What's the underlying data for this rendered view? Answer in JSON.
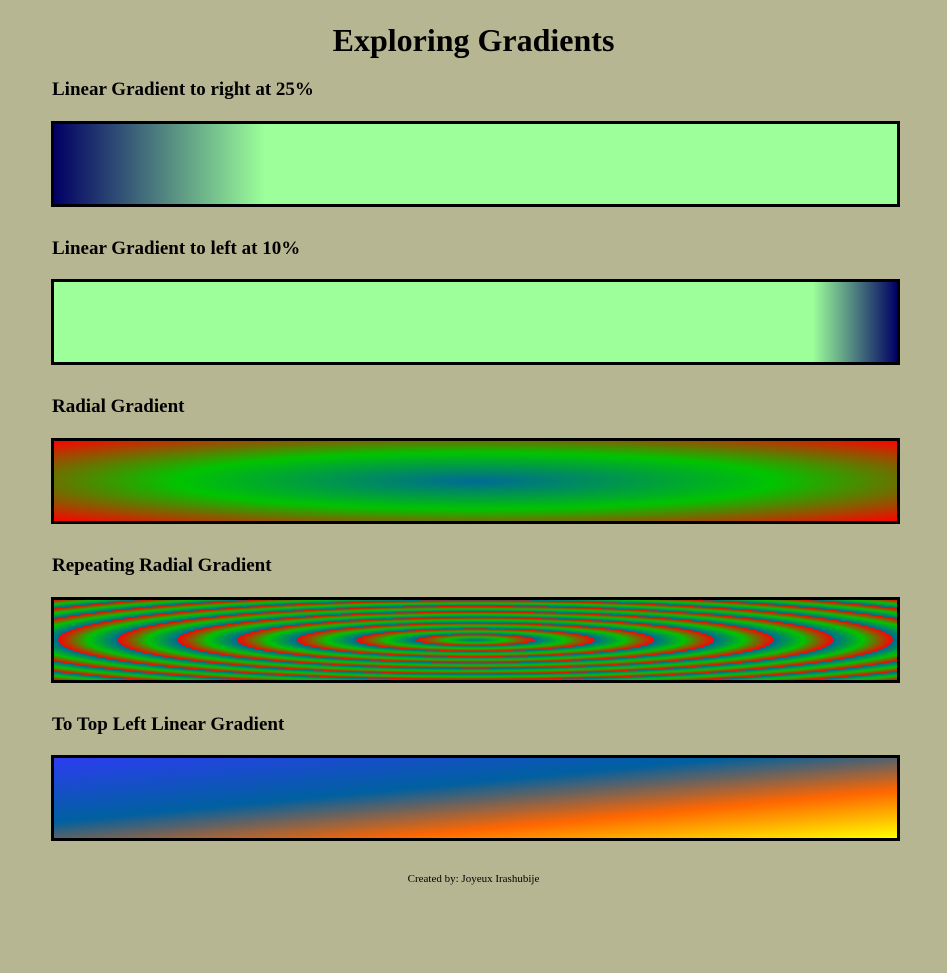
{
  "page": {
    "title": "Exploring Gradients",
    "background_color": "#b7b693"
  },
  "sections": [
    {
      "heading": "Linear Gradient to right at 25%",
      "gradient": "linear",
      "direction": "to right",
      "colors": [
        "#000064",
        "#9cff9a"
      ]
    },
    {
      "heading": "Linear Gradient to left at 10%",
      "gradient": "linear",
      "direction": "to left",
      "colors": [
        "#000064",
        "#9cff9a"
      ]
    },
    {
      "heading": "Radial Gradient",
      "gradient": "radial",
      "colors": [
        "#006a96",
        "#00c400",
        "#ff0000"
      ]
    },
    {
      "heading": "Repeating Radial Gradient",
      "gradient": "repeating-radial",
      "colors": [
        "#006a96",
        "#00c400",
        "#ff0000"
      ]
    },
    {
      "heading": "To Top Left Linear Gradient",
      "gradient": "linear",
      "direction": "to top left",
      "colors": [
        "#ffff00",
        "#ff6600",
        "#0060a0",
        "#2c3cf0"
      ]
    }
  ],
  "footer": {
    "text": "Created by: Joyeux Irashubije"
  }
}
